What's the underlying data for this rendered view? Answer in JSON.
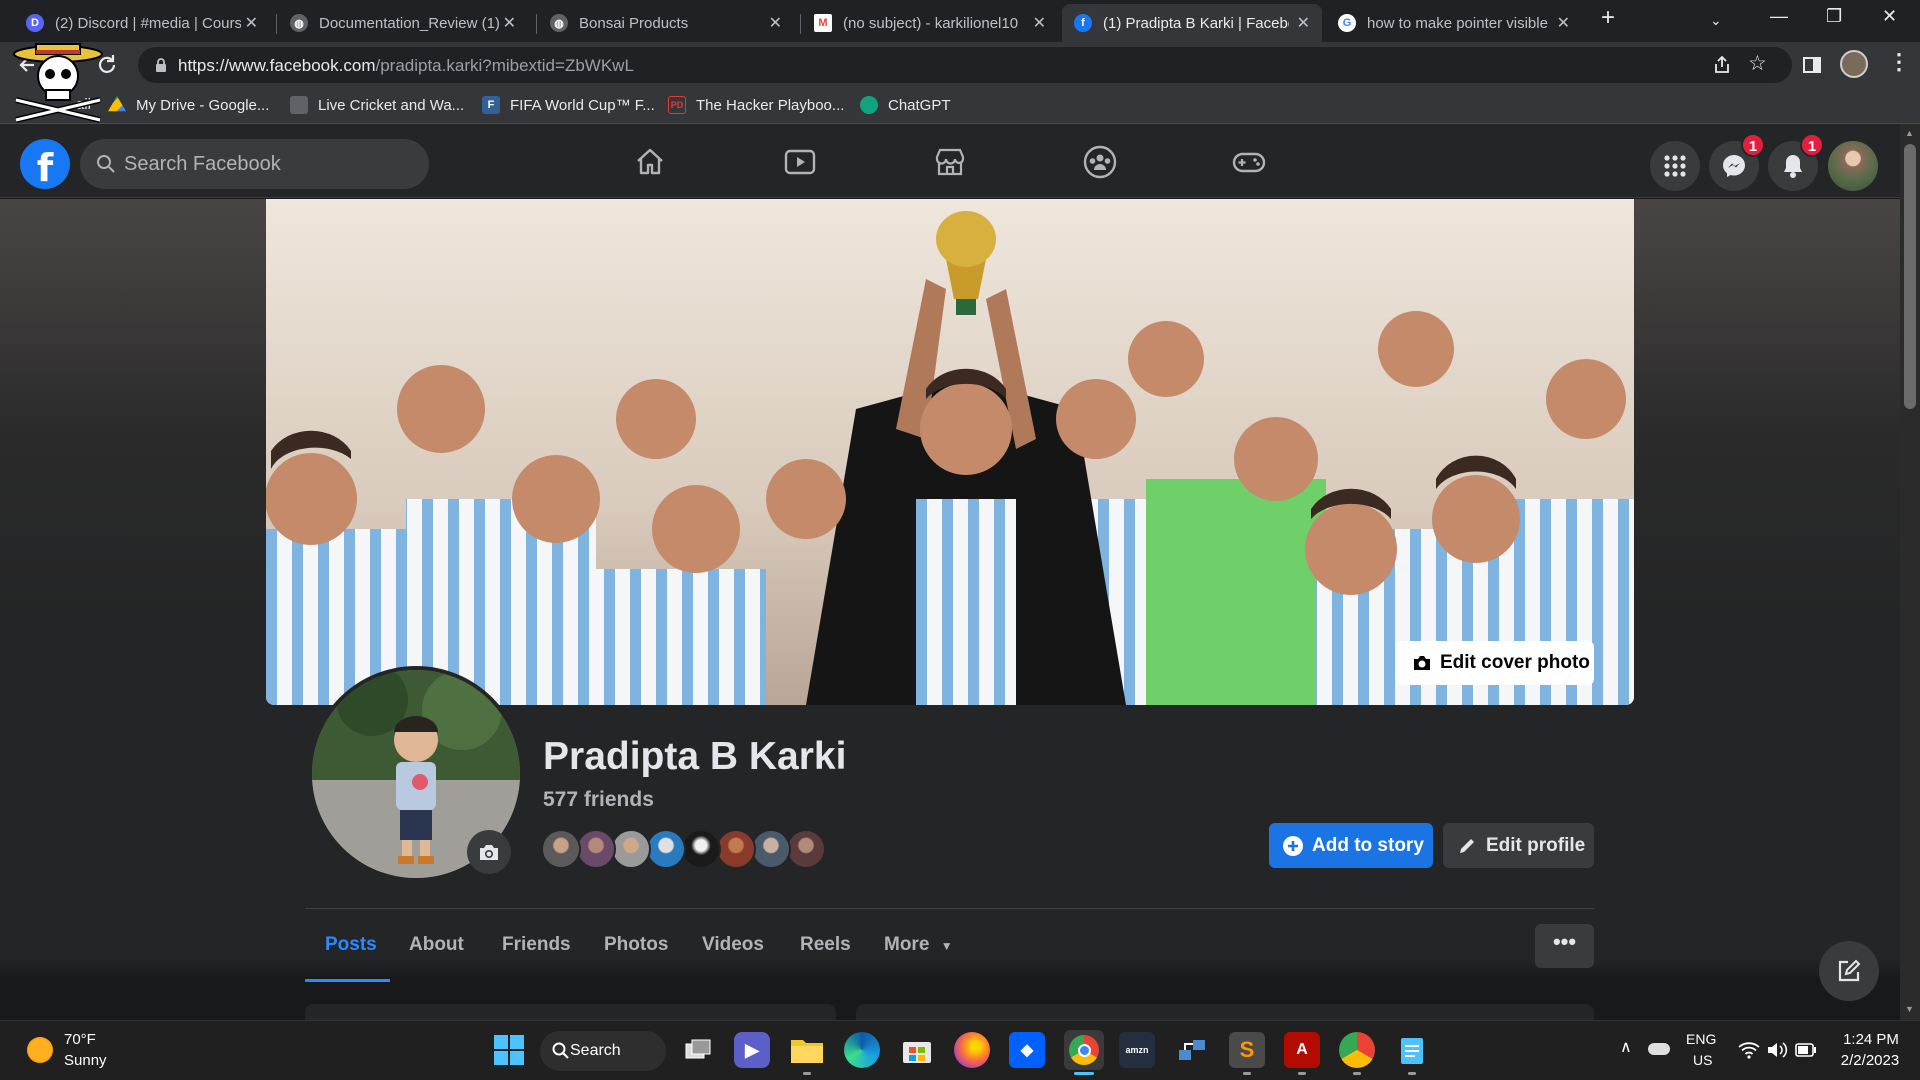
{
  "browser": {
    "tabs": [
      {
        "title": "(2) Discord | #media | Cours",
        "icon": "discord-icon"
      },
      {
        "title": "Documentation_Review (1)",
        "icon": "globe-icon"
      },
      {
        "title": "Bonsai Products",
        "icon": "globe-icon"
      },
      {
        "title": "(no subject) - karkilionel10",
        "icon": "gmail-icon"
      },
      {
        "title": "(1) Pradipta B Karki | Facebo",
        "icon": "facebook-icon",
        "active": true
      },
      {
        "title": "how to make pointer visible",
        "icon": "google-icon"
      }
    ],
    "url_host": "https://www.facebook.com",
    "url_path": "/pradipta.karki?mibextid=ZbWKwL",
    "bookmarks": [
      {
        "label": "ail",
        "icon": "gmail-icon"
      },
      {
        "label": "My Drive - Google...",
        "icon": "drive-icon"
      },
      {
        "label": "Live Cricket and Wa...",
        "icon": "folder-icon"
      },
      {
        "label": "FIFA World Cup™ F...",
        "icon": "fifa-icon"
      },
      {
        "label": "The Hacker Playboo...",
        "icon": "pdf-icon"
      },
      {
        "label": "ChatGPT",
        "icon": "chatgpt-icon"
      }
    ]
  },
  "facebook": {
    "search_placeholder": "Search Facebook",
    "messenger_badge": "1",
    "notifications_badge": "1",
    "profile": {
      "name": "Pradipta B Karki",
      "friends": "577 friends",
      "edit_cover": "Edit cover photo",
      "add_story": "Add to story",
      "edit_profile": "Edit profile"
    },
    "tabs": [
      "Posts",
      "About",
      "Friends",
      "Photos",
      "Videos",
      "Reels",
      "More"
    ],
    "more_dots": "•••"
  },
  "taskbar": {
    "weather_temp": "70°F",
    "weather_desc": "Sunny",
    "search_label": "Search",
    "lang_top": "ENG",
    "lang_bottom": "US",
    "time": "1:24 PM",
    "date": "2/2/2023"
  },
  "colors": {
    "fb_blue": "#1b74e4",
    "tab_active": "#2d88ff",
    "badge_red": "#e41e3f"
  }
}
